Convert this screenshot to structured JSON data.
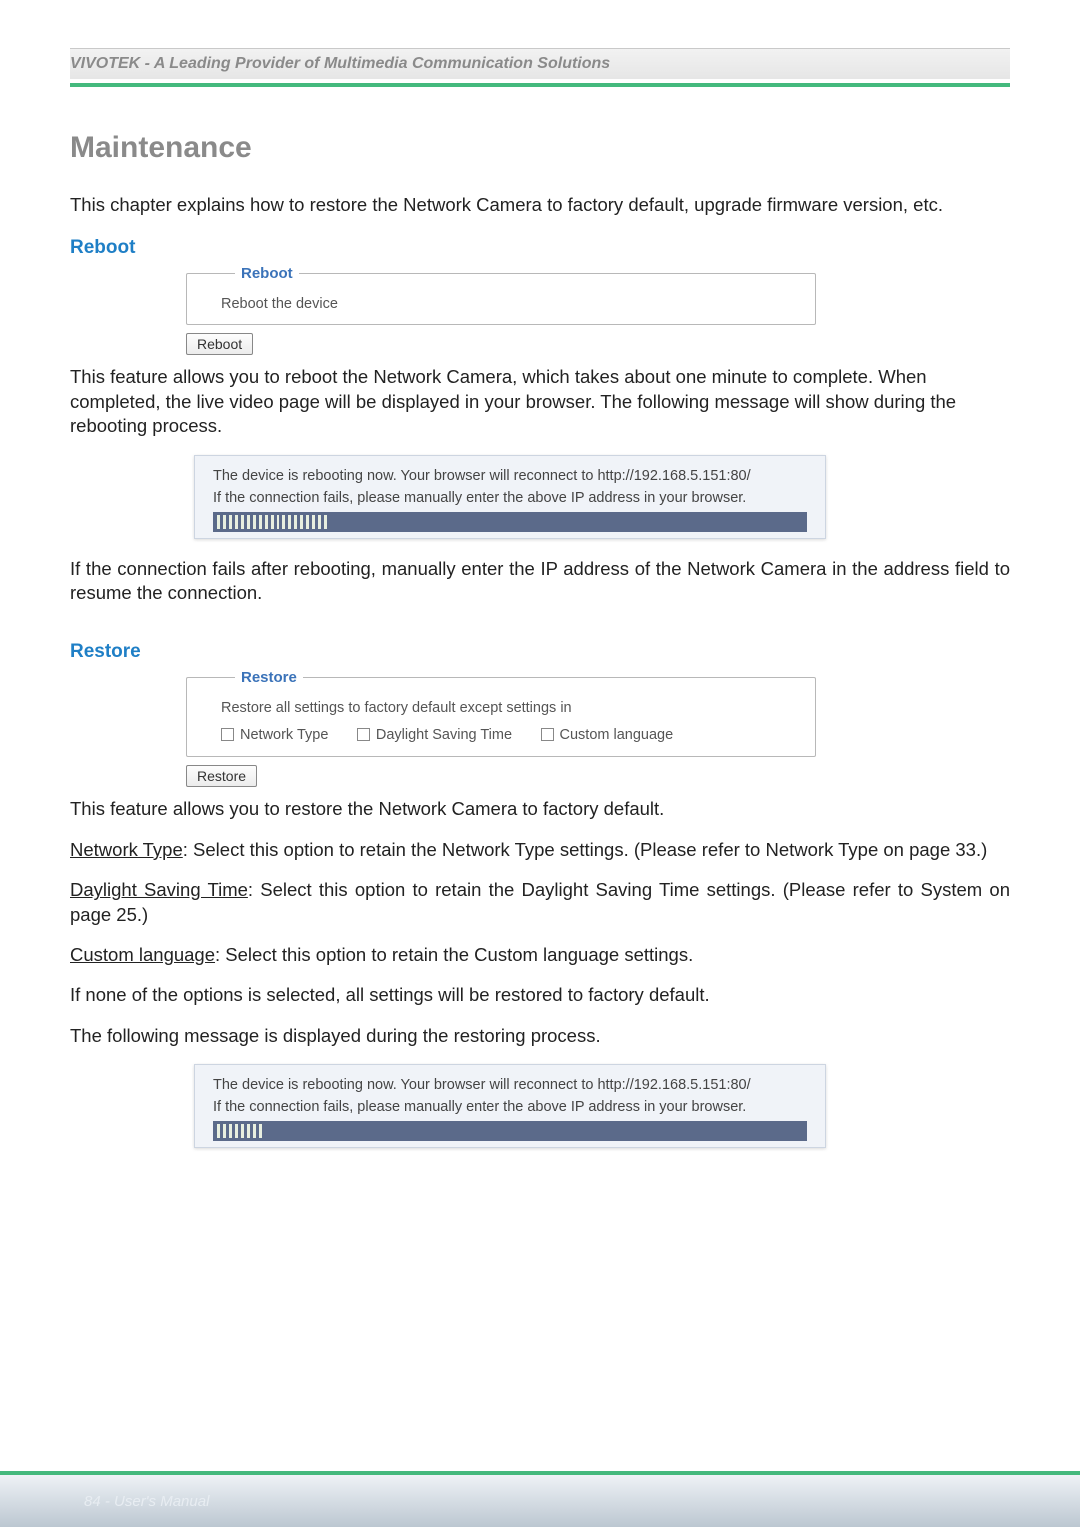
{
  "header": {
    "brand": "VIVOTEK - A Leading Provider of Multimedia Communication Solutions"
  },
  "title": "Maintenance",
  "intro": "This chapter explains how to restore the Network Camera to factory default, upgrade firmware version, etc.",
  "reboot": {
    "heading": "Reboot",
    "panel_legend": "Reboot",
    "panel_text": "Reboot the device",
    "button": "Reboot",
    "desc": "This feature allows you to reboot the Network Camera, which takes about one minute to complete. When completed, the live video page will be displayed in your browser. The following message will show during the rebooting process.",
    "msg1": "The device is rebooting now. Your browser will reconnect to http://192.168.5.151:80/",
    "msg2": "If the connection fails, please manually enter the above IP address in your browser.",
    "after": "If the connection fails after rebooting, manually enter the IP address of the Network Camera in the address field to resume the connection."
  },
  "restore": {
    "heading": "Restore",
    "panel_legend": "Restore",
    "panel_text": "Restore all settings to factory default except settings in",
    "options": [
      "Network Type",
      "Daylight Saving Time",
      "Custom language"
    ],
    "button": "Restore",
    "desc": "This feature allows you to restore the Network Camera to factory default.",
    "opt_net_label": "Network Type",
    "opt_net_text": ": Select this option to retain the Network Type settings. (Please refer to Network Type on page 33.)",
    "opt_dst_label": "Daylight Saving Time",
    "opt_dst_text": ": Select this option to retain the Daylight Saving Time settings. (Please refer to System on page 25.)",
    "opt_lang_label": "Custom language",
    "opt_lang_text": ": Select this option to retain the Custom language settings.",
    "none_text": "If none of the options is selected, all settings will be restored to factory default.",
    "following_text": "The following message is displayed during the restoring process.",
    "msg1": "The device is rebooting now. Your browser will reconnect to http://192.168.5.151:80/",
    "msg2": "If the connection fails, please manually enter the above IP address in your browser."
  },
  "footer": {
    "page": "84 - User's Manual"
  }
}
